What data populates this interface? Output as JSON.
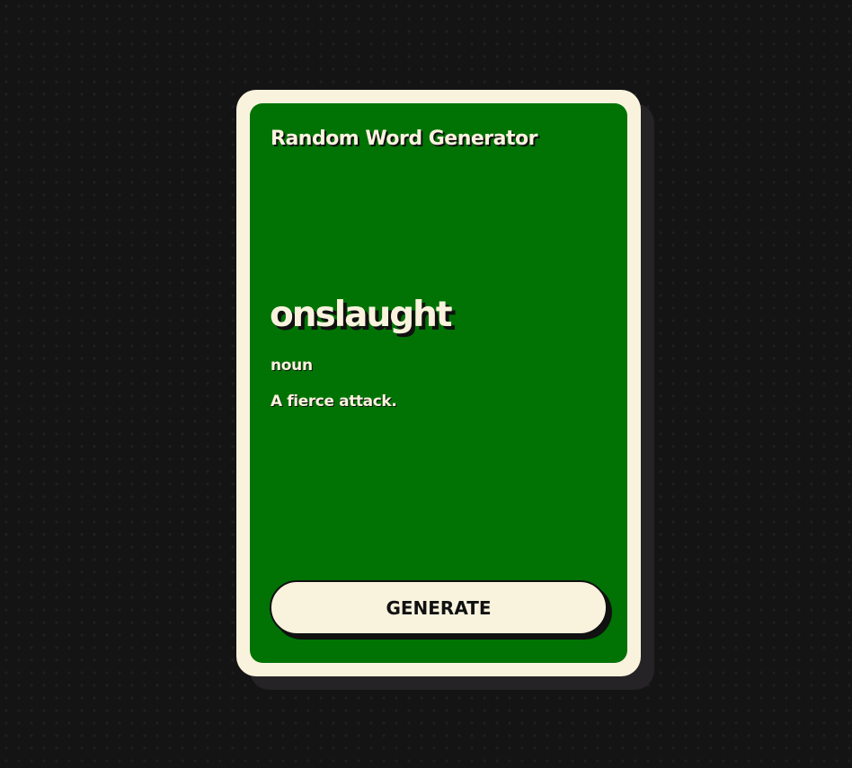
{
  "app": {
    "title": "Random Word Generator"
  },
  "entry": {
    "word": "onslaught",
    "part_of_speech": "noun",
    "definition": "A fierce attack."
  },
  "actions": {
    "generate_label": "GENERATE"
  },
  "colors": {
    "card_green": "#007304",
    "cream": "#f9f3de",
    "ink": "#111111",
    "background": "#141414"
  }
}
